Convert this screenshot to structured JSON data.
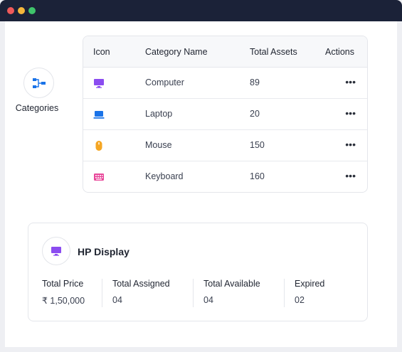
{
  "window": {
    "controls": [
      "close",
      "minimize",
      "maximize"
    ]
  },
  "side": {
    "label": "Categories",
    "icon": "hierarchy-icon",
    "icon_color": "#1a73e8"
  },
  "table": {
    "headers": {
      "icon": "Icon",
      "name": "Category Name",
      "total": "Total Assets",
      "actions": "Actions"
    },
    "rows": [
      {
        "icon": "monitor-icon",
        "color": "#8b4cf0",
        "name": "Computer",
        "total": "89",
        "action": "•••"
      },
      {
        "icon": "laptop-icon",
        "color": "#1a73e8",
        "name": "Laptop",
        "total": "20",
        "action": "•••"
      },
      {
        "icon": "mouse-icon",
        "color": "#f5a623",
        "name": "Mouse",
        "total": "150",
        "action": "•••"
      },
      {
        "icon": "keyboard-icon",
        "color": "#e8479a",
        "name": "Keyboard",
        "total": "160",
        "action": "•••"
      }
    ]
  },
  "detail": {
    "title": "HP Display",
    "icon": "monitor-icon",
    "icon_color": "#8b4cf0",
    "stats": [
      {
        "label": "Total Price",
        "value": "₹ 1,50,000"
      },
      {
        "label": "Total Assigned",
        "value": "04"
      },
      {
        "label": "Total Available",
        "value": "04"
      },
      {
        "label": "Expired",
        "value": "02"
      }
    ]
  }
}
